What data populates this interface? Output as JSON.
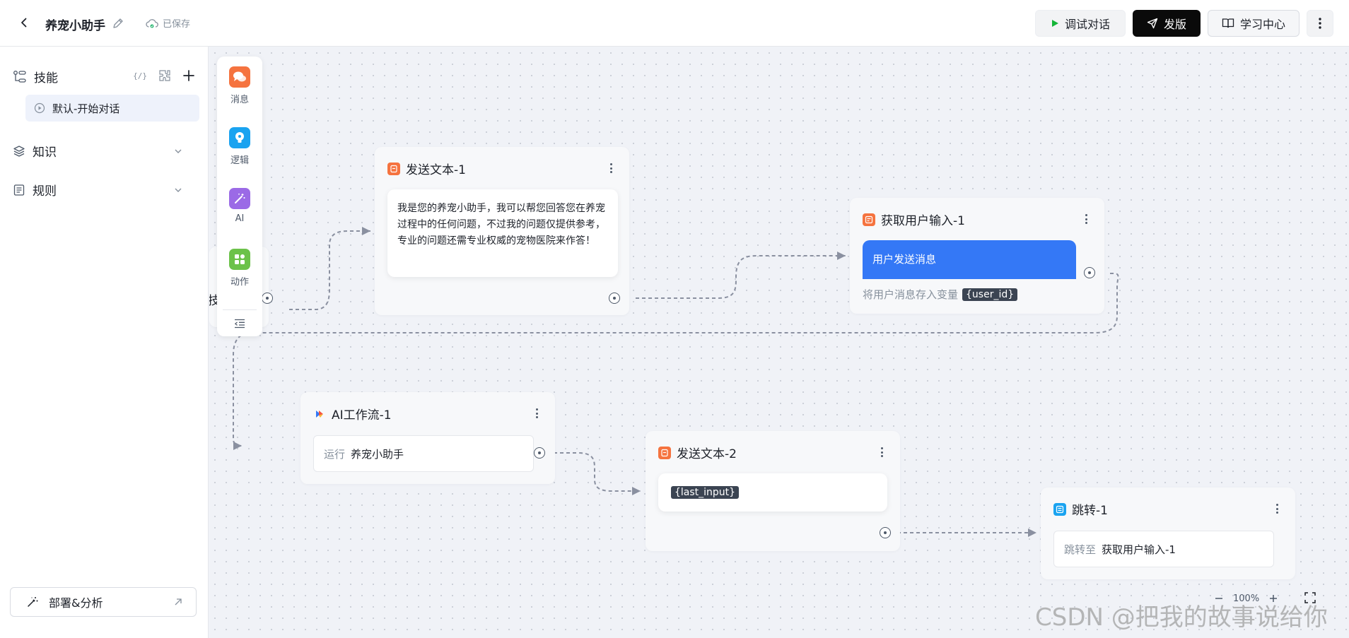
{
  "header": {
    "app_title": "养宠小助手",
    "save_status": "已保存",
    "debug_label": "调试对话",
    "publish_label": "发版",
    "learn_label": "学习中心"
  },
  "sidebar": {
    "skill_label": "技能",
    "skill_tool_code": "{/}",
    "default_flow": "默认-开始对话",
    "knowledge_label": "知识",
    "rules_label": "规则",
    "deploy_label": "部署&分析"
  },
  "palette": {
    "items": [
      {
        "label": "消息",
        "icon": "message-icon",
        "color": "#f5733f"
      },
      {
        "label": "逻辑",
        "icon": "logic-icon",
        "color": "#1aa3f0"
      },
      {
        "label": "AI",
        "icon": "ai-wand-icon",
        "color": "#9b6ae6"
      },
      {
        "label": "动作",
        "icon": "action-icon",
        "color": "#6cc24a"
      }
    ]
  },
  "nodes": {
    "start_fragment": "技",
    "send_text_1": {
      "title": "发送文本-1",
      "message": "我是您的养宠小助手，我可以帮您回答您在养宠过程中的任何问题，不过我的问题仅提供参考，专业的问题还需专业权威的宠物医院来作答！",
      "icon_color": "#f5733f"
    },
    "get_input_1": {
      "title": "获取用户输入-1",
      "user_message": "用户发送消息",
      "store_label": "将用户消息存入变量",
      "variable": "{user_id}",
      "icon_color": "#f5733f",
      "bubble_color": "#3478f6"
    },
    "ai_workflow_1": {
      "title": "AI工作流-1",
      "run_label": "运行",
      "run_target": "养宠小助手"
    },
    "send_text_2": {
      "title": "发送文本-2",
      "variable": "{last_input}",
      "icon_color": "#f5733f"
    },
    "jump_1": {
      "title": "跳转-1",
      "jump_label": "跳转至",
      "jump_target": "获取用户输入-1",
      "icon_color": "#1aa3f0"
    }
  },
  "canvas": {
    "zoom_level": "100%"
  },
  "watermark": "CSDN @把我的故事说给你"
}
